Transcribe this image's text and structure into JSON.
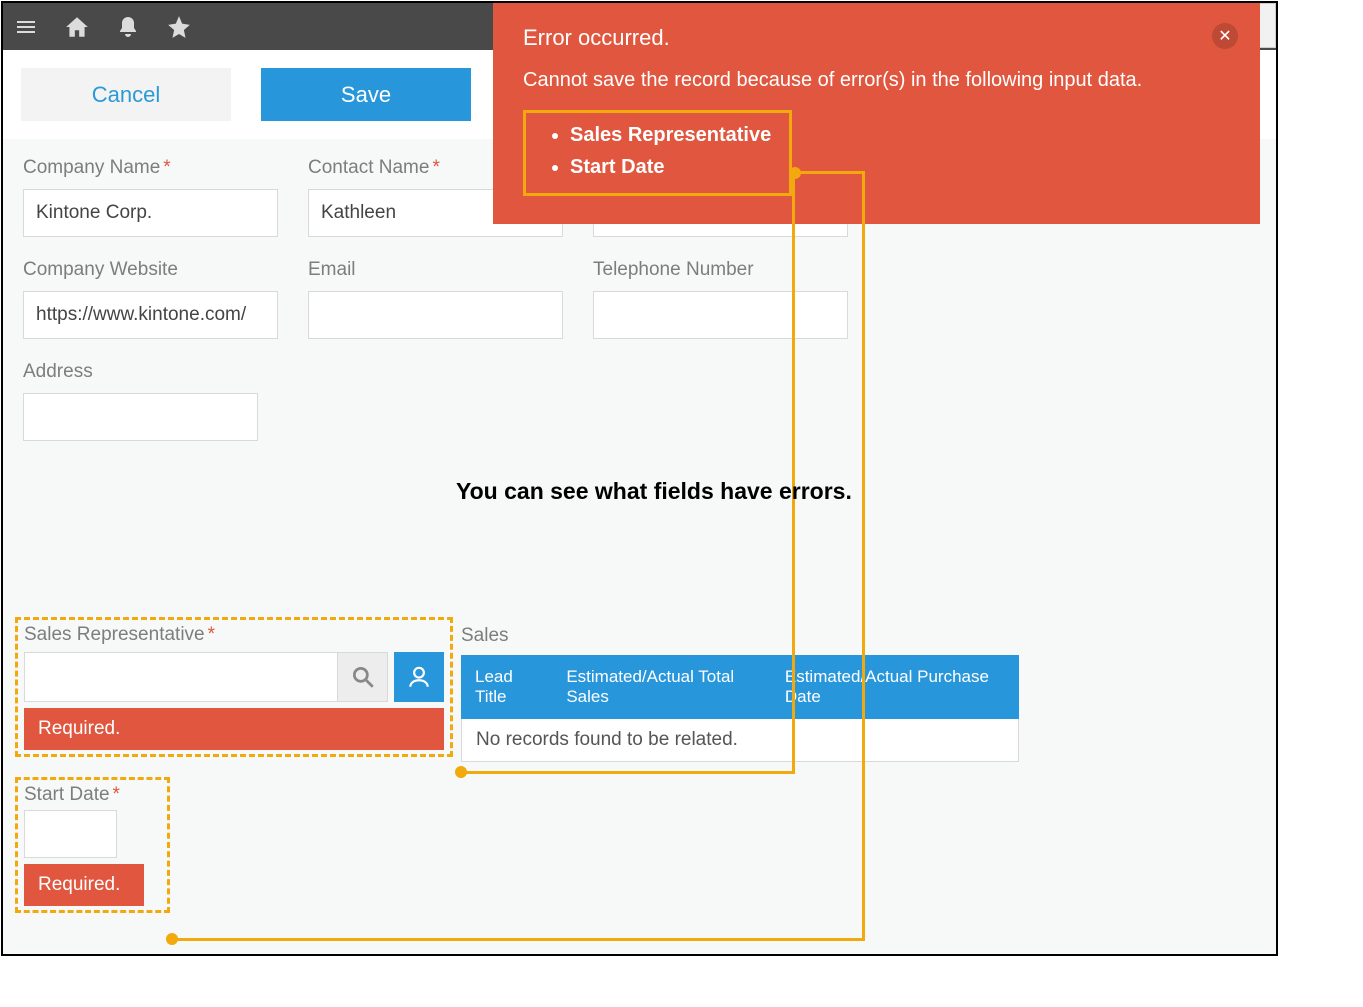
{
  "topbar": {
    "icons": [
      "menu-icon",
      "home-icon",
      "bell-icon",
      "star-icon"
    ]
  },
  "actions": {
    "cancel": "Cancel",
    "save": "Save"
  },
  "error": {
    "title": "Error occurred.",
    "message": "Cannot save the record because of error(s) in the following input data.",
    "fields": [
      "Sales Representative",
      "Start Date"
    ]
  },
  "annotation": "You can see what fields have errors.",
  "form": {
    "company_name": {
      "label": "Company Name",
      "required": true,
      "value": "Kintone Corp."
    },
    "contact_name": {
      "label": "Contact Name",
      "required": true,
      "value": "Kathleen"
    },
    "contact_extra": {
      "value": ""
    },
    "company_website": {
      "label": "Company Website",
      "value": "https://www.kintone.com/"
    },
    "email": {
      "label": "Email",
      "value": ""
    },
    "telephone": {
      "label": "Telephone Number",
      "value": ""
    },
    "address": {
      "label": "Address",
      "value": ""
    },
    "sales_rep": {
      "label": "Sales Representative",
      "required": true,
      "value": "",
      "error": "Required."
    },
    "start_date": {
      "label": "Start Date",
      "required": true,
      "value": "",
      "error": "Required."
    }
  },
  "sales_table": {
    "label": "Sales",
    "columns": [
      "Lead Title",
      "Estimated/Actual Total Sales",
      "Estimated/Actual Purchase Date"
    ],
    "empty": "No records found to be related."
  }
}
